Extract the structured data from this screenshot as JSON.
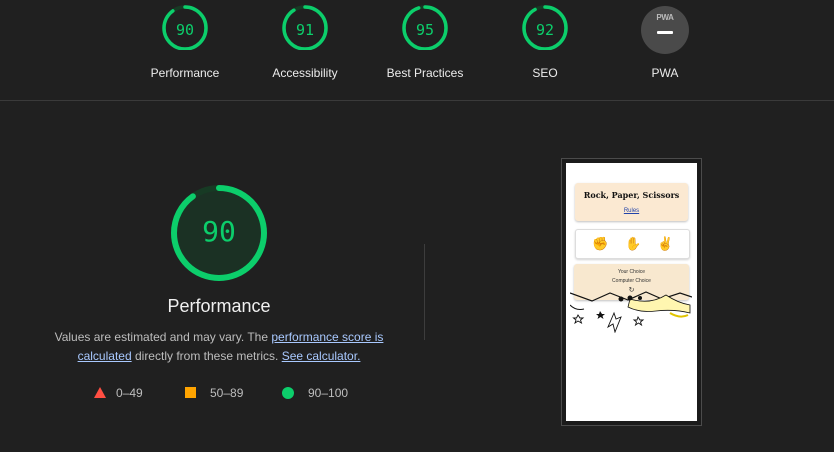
{
  "top_scores": [
    {
      "label": "Performance",
      "score": "90",
      "fraction": 0.9
    },
    {
      "label": "Accessibility",
      "score": "91",
      "fraction": 0.91
    },
    {
      "label": "Best Practices",
      "score": "95",
      "fraction": 0.95
    },
    {
      "label": "SEO",
      "score": "92",
      "fraction": 0.92
    },
    {
      "label": "PWA",
      "badge_text": "PWA"
    }
  ],
  "main": {
    "score": "90",
    "fraction": 0.9,
    "title": "Performance",
    "desc_prefix": "Values are estimated and may vary. The ",
    "desc_link1": "performance score is calculated",
    "desc_middle": " directly from these metrics. ",
    "desc_link2": "See calculator."
  },
  "legend": [
    {
      "range": "0–49",
      "color": "#ff4e42"
    },
    {
      "range": "50–89",
      "color": "#ffa400"
    },
    {
      "range": "90–100",
      "color": "#0cce6b"
    }
  ],
  "screenshot": {
    "title": "Rock, Paper, Scissors",
    "link": "Rules",
    "choice_line": "Your Choice",
    "computer_line": "Computer Choice",
    "reset_glyph": "↻",
    "hand_glyphs": [
      "✊",
      "✋",
      "✌"
    ]
  },
  "colors": {
    "good": "#0cce6b",
    "average": "#ffa400",
    "fail": "#ff4e42",
    "background": "#202020"
  }
}
